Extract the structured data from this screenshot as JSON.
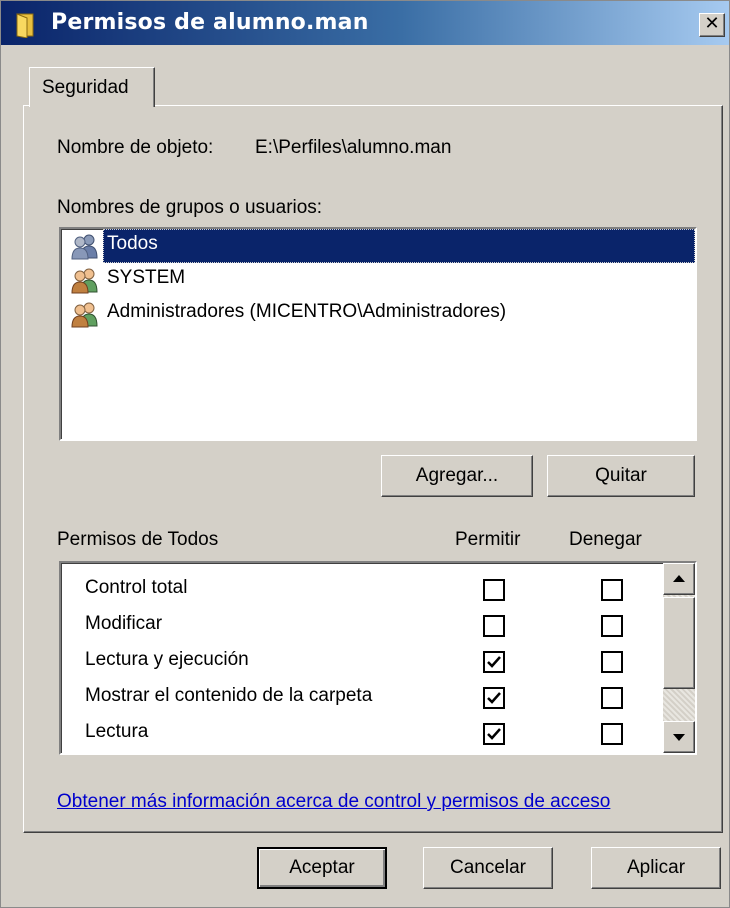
{
  "window": {
    "title": "Permisos de alumno.man",
    "close_glyph": "✕"
  },
  "tabs": [
    {
      "label": "Seguridad",
      "active": true
    }
  ],
  "object": {
    "label": "Nombre de objeto:",
    "value": "E:\\Perfiles\\alumno.man"
  },
  "groups": {
    "label": "Nombres de grupos o usuarios:",
    "items": [
      {
        "label": "Todos",
        "icon": "users-group-icon",
        "selected": true
      },
      {
        "label": "SYSTEM",
        "icon": "users-group-icon",
        "selected": false
      },
      {
        "label": "Administradores (MICENTRO\\Administradores)",
        "icon": "users-group-icon",
        "selected": false
      }
    ],
    "add_label": "Agregar...",
    "remove_label": "Quitar"
  },
  "permissions": {
    "label": "Permisos de Todos",
    "allow_header": "Permitir",
    "deny_header": "Denegar",
    "rows": [
      {
        "label": "Control total",
        "allow": false,
        "deny": false
      },
      {
        "label": "Modificar",
        "allow": false,
        "deny": false
      },
      {
        "label": "Lectura y ejecución",
        "allow": true,
        "deny": false
      },
      {
        "label": "Mostrar el contenido de la carpeta",
        "allow": true,
        "deny": false
      },
      {
        "label": "Lectura",
        "allow": true,
        "deny": false
      }
    ]
  },
  "help_link": "Obtener más información acerca de control y permisos de acceso",
  "footer": {
    "ok_label": "Aceptar",
    "cancel_label": "Cancelar",
    "apply_label": "Aplicar"
  },
  "colors": {
    "titlebar_start": "#0a246a",
    "titlebar_end": "#a6caf0",
    "selection": "#0a246a",
    "face": "#d4d0c8",
    "link": "#0000cc"
  }
}
